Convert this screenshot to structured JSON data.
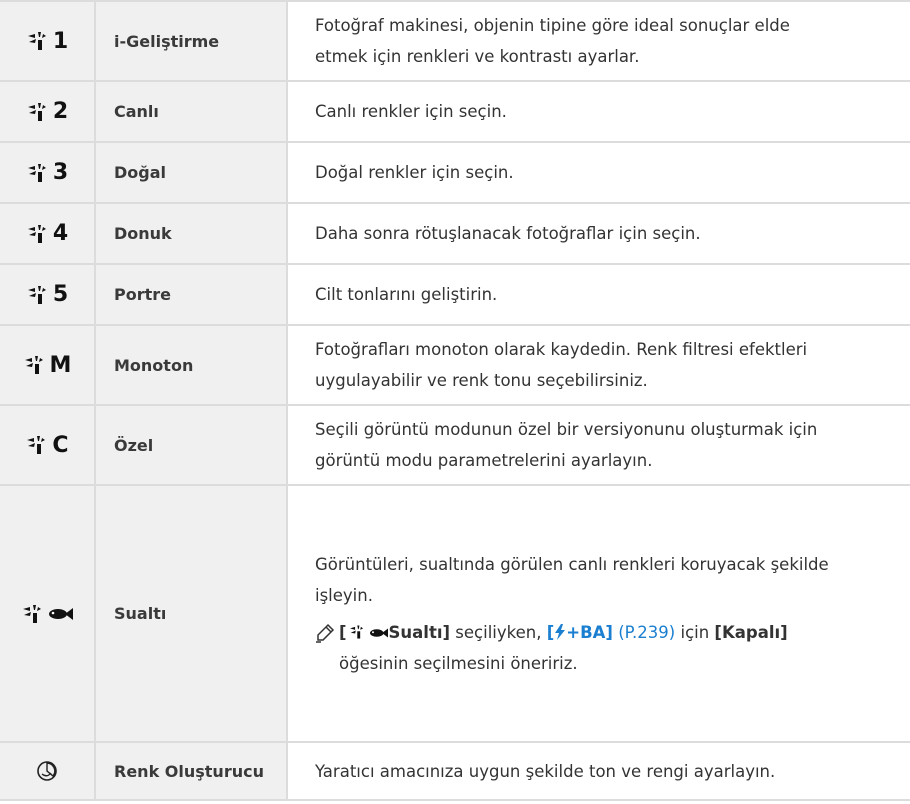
{
  "colors": {
    "header_bg": "#f0f0f0",
    "border": "#dcdcdc",
    "link": "#1a7fd0",
    "text": "#333333"
  },
  "rows": [
    {
      "code": "1",
      "name": "i-Geliştirme",
      "desc_lines": [
        "Fotoğraf makinesi, objenin tipine göre ideal sonuçlar elde",
        "etmek için renkleri ve kontrastı ayarlar."
      ]
    },
    {
      "code": "2",
      "name": "Canlı",
      "desc_lines": [
        "Canlı renkler için seçin."
      ]
    },
    {
      "code": "3",
      "name": "Doğal",
      "desc_lines": [
        "Doğal renkler için seçin."
      ]
    },
    {
      "code": "4",
      "name": "Donuk",
      "desc_lines": [
        "Daha sonra rötuşlanacak fotoğraflar için seçin."
      ]
    },
    {
      "code": "5",
      "name": "Portre",
      "desc_lines": [
        "Cilt tonlarını geliştirin."
      ]
    },
    {
      "code": "M",
      "name": "Monoton",
      "desc_lines": [
        "Fotoğrafları monoton olarak kaydedin. Renk filtresi efektleri",
        "uygulayabilir ve renk tonu seçebilirsiniz."
      ]
    },
    {
      "code": "C",
      "name": "Özel",
      "desc_lines": [
        "Seçili görüntü modunun özel bir versiyonunu oluşturmak için",
        "görüntü modu parametrelerini ayarlayın."
      ]
    },
    {
      "code": "",
      "name": "Sualtı",
      "desc_lines": [
        "Görüntüleri, sualtında görülen canlı renkleri koruyacak şekilde",
        "işleyin."
      ],
      "note": {
        "open_bracket": "[",
        "ref_label": "Sualtı]",
        "mid_text": " seçiliyken, ",
        "flash_label": "[",
        "flash_suffix": "+BA]",
        "page_ref": "(P.239)",
        "for_text": " için ",
        "value": "[Kapalı]",
        "line2": "öğesinin seçilmesini öneririz."
      }
    },
    {
      "code": "",
      "name": "Renk Oluşturucu",
      "desc_lines": [
        "Yaratıcı amacınıza uygun şekilde ton ve rengi ayarlayın."
      ]
    }
  ],
  "icons": {
    "picture_mode": "picture-mode-icon",
    "underwater": "fish-icon",
    "color_creator": "color-creator-icon",
    "note": "note-pencil-icon",
    "flash": "flash-icon"
  }
}
